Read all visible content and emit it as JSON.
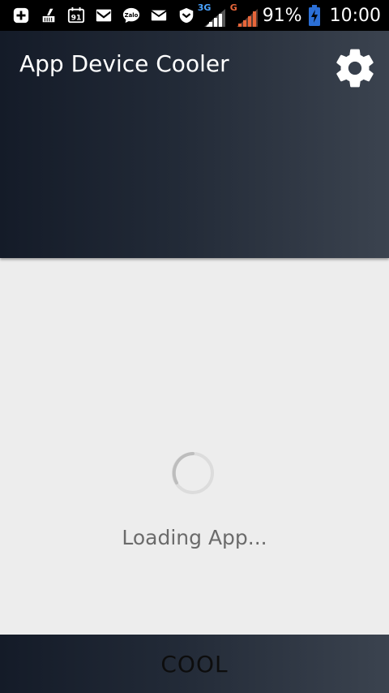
{
  "status_bar": {
    "icons": [
      "add-box-icon",
      "cleaner-icon",
      "calendar-icon",
      "gmail-icon",
      "zalo-icon",
      "mail-icon",
      "shield-icon"
    ],
    "zalo_label": "Zalo",
    "calendar_label": "91",
    "network1_label": "3G",
    "network2_label": "G",
    "battery_percent": "91%",
    "time": "10:00"
  },
  "header": {
    "title": "App Device Cooler"
  },
  "loading": {
    "text": "Loading App..."
  },
  "bottom": {
    "button_label": "COOL"
  },
  "colors": {
    "status_bar": "#000000",
    "header_dark": "#141b28",
    "header_light": "#3b434f",
    "background": "#ededed",
    "loading_text": "#6b6b6b",
    "battery_blue": "#2b6fd6",
    "signal_orange": "#e8663a",
    "network_3g_blue": "#4aa3ff"
  }
}
